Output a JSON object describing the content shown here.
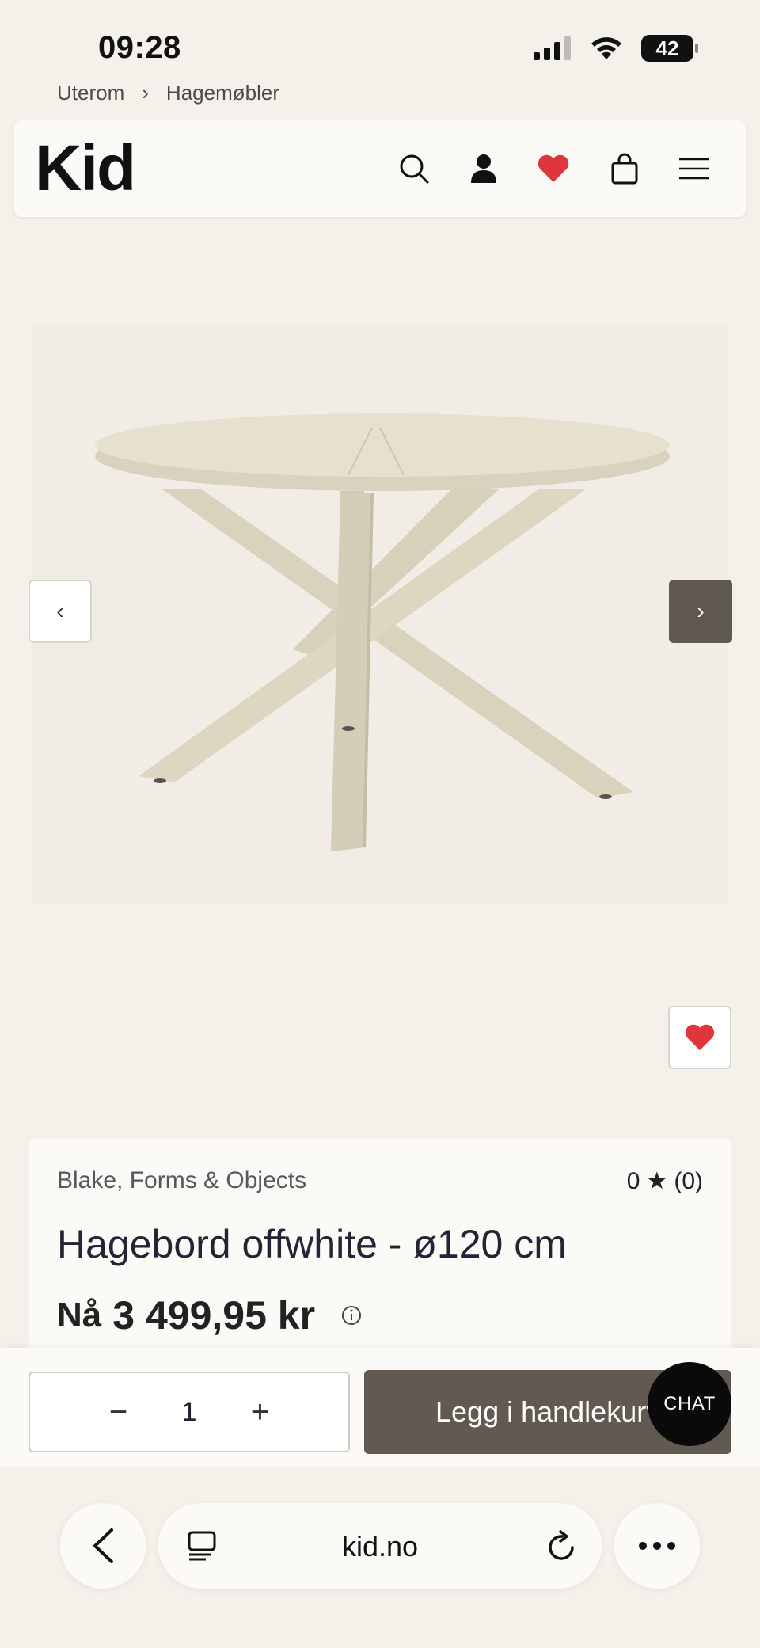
{
  "status_bar": {
    "time": "09:28",
    "battery": "42"
  },
  "breadcrumb": {
    "items": [
      "Uterom",
      "Hagemøbler"
    ],
    "separator": "›"
  },
  "header": {
    "logo": "Kid",
    "icons": [
      "search-icon",
      "user-icon",
      "heart-icon",
      "bag-icon",
      "menu-icon"
    ],
    "accent": "#e0353b"
  },
  "product": {
    "prev_label": "‹",
    "next_label": "›",
    "brand": "Blake, Forms & Objects",
    "rating_value": "0",
    "rating_star": "★",
    "rating_count": "(0)",
    "title": "Hagebord offwhite - ø120 cm",
    "price_label": "Nå",
    "price": "3 499,95 kr"
  },
  "actions": {
    "qty_minus": "−",
    "qty_value": "1",
    "qty_plus": "+",
    "add_to_cart": "Legg i handlekurv",
    "chat": "CHAT",
    "button_color": "#625a50"
  },
  "browser": {
    "url": "kid.no"
  }
}
